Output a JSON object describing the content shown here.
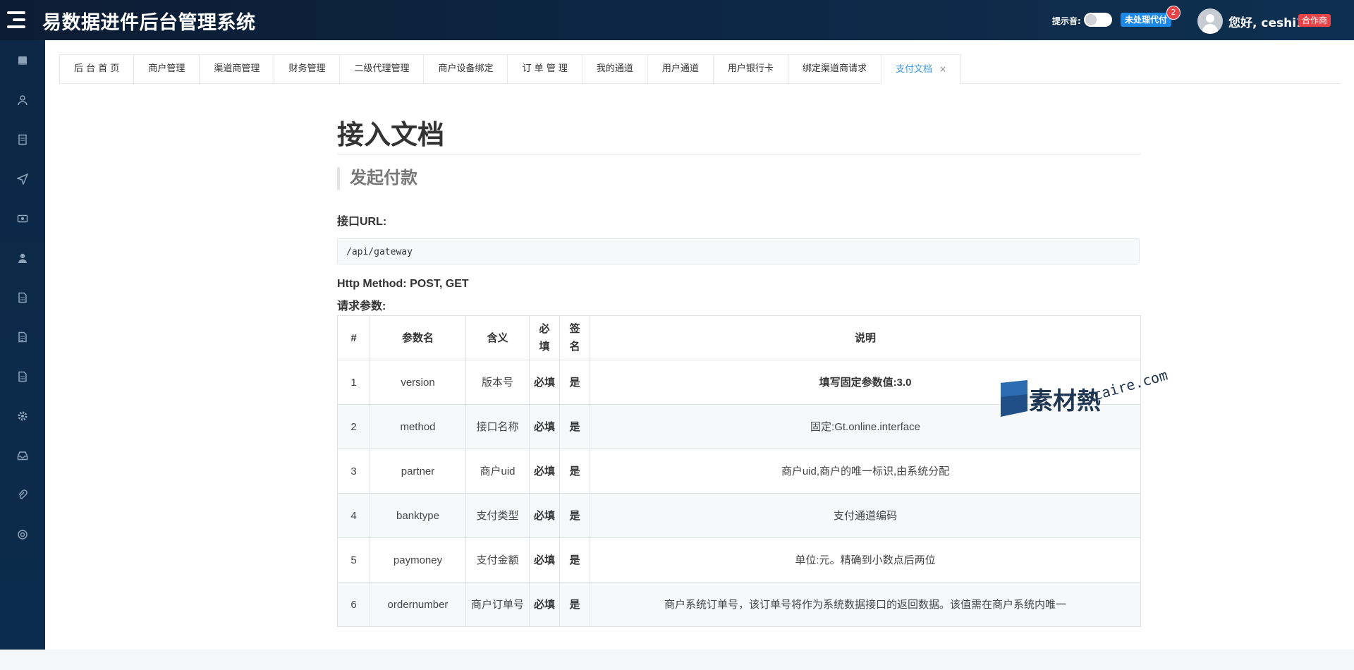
{
  "app": {
    "title": "易数据进件后台管理系统",
    "sound_label": "提示音:",
    "pending_label": "未处理代付",
    "pending_count": "2",
    "greeting": "您好, ceshi1",
    "role": "合作商"
  },
  "sidebar": {
    "items": [
      {
        "icon": "book-icon"
      },
      {
        "icon": "user-outline-icon"
      },
      {
        "icon": "document-icon"
      },
      {
        "icon": "send-icon"
      },
      {
        "icon": "money-icon"
      },
      {
        "icon": "user-icon"
      },
      {
        "icon": "file-icon"
      },
      {
        "icon": "file-text-icon"
      },
      {
        "icon": "file-list-icon"
      },
      {
        "icon": "gear-icon"
      },
      {
        "icon": "inbox-icon"
      },
      {
        "icon": "paperclip-icon"
      },
      {
        "icon": "lifebuoy-icon"
      }
    ]
  },
  "tabs": [
    {
      "label": "后 台 首 页"
    },
    {
      "label": "商户管理"
    },
    {
      "label": "渠道商管理"
    },
    {
      "label": "财务管理"
    },
    {
      "label": "二级代理管理"
    },
    {
      "label": "商户设备绑定"
    },
    {
      "label": "订 单 管 理"
    },
    {
      "label": "我的通道"
    },
    {
      "label": "用户通道"
    },
    {
      "label": "用户银行卡"
    },
    {
      "label": "绑定渠道商请求"
    },
    {
      "label": "支付文档",
      "active": true,
      "close": "×"
    }
  ],
  "doc": {
    "title": "接入文档",
    "section": "发起付款",
    "url_label": "接口URL:",
    "url": "/api/gateway",
    "method_label": "Http Method: POST, GET",
    "params_label": "请求参数:",
    "table": {
      "headers": [
        "#",
        "参数名",
        "含义",
        "必\n填",
        "签\n名",
        "说明"
      ],
      "rows": [
        [
          "1",
          "version",
          "版本号",
          "必填",
          "是",
          "填写固定参数值:3.0"
        ],
        [
          "2",
          "method",
          "接口名称",
          "必填",
          "是",
          "固定:Gt.online.interface"
        ],
        [
          "3",
          "partner",
          "商户uid",
          "必填",
          "是",
          "商户uid,商户的唯一标识,由系统分配"
        ],
        [
          "4",
          "banktype",
          "支付类型",
          "必填",
          "是",
          "支付通道编码"
        ],
        [
          "5",
          "paymoney",
          "支付金额",
          "必填",
          "是",
          "单位:元。精确到小数点后两位"
        ],
        [
          "6",
          "ordernumber",
          "商户订单号",
          "必填",
          "是",
          "商户系统订单号，该订单号将作为系统数据接口的返回数据。该值需在商户系统内唯一"
        ]
      ]
    }
  },
  "watermark": {
    "text": "素材熱",
    "url": "sucaire.com"
  }
}
